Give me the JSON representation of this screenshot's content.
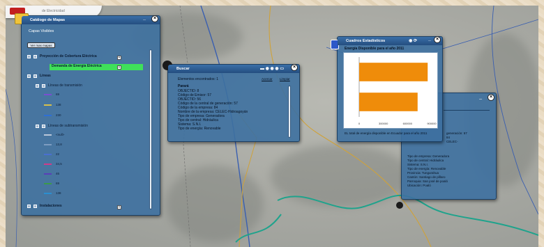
{
  "logo": {
    "caption": "de Electricidad"
  },
  "colors": {
    "panel": "#3d70a0",
    "active_row": "#3fe05a",
    "bar": "#ef8c0a"
  },
  "catalog": {
    "title": "Catálogo de Mapas",
    "subtitle": "Capas Visibles",
    "more_button": "Ver mas mapas",
    "minimize": "_",
    "layers": [
      {
        "label": "Proyección de Cobertura Eléctrica"
      },
      {
        "label": "Demanda de Energía Eléctrica",
        "active": true
      },
      {
        "label": "Líneas"
      },
      {
        "label": "Líneas de transmisión"
      },
      {
        "label": "Líneas de subtransmisión"
      },
      {
        "label": "Instalaciones"
      }
    ],
    "transmission_legend": [
      "69",
      "138",
      "230"
    ],
    "subtransmission_legend": [
      "<null>",
      "13,8",
      "22",
      "34,5",
      "46",
      "69",
      "138"
    ]
  },
  "buscar": {
    "title": "Buscar",
    "found": "Elementos encontrados: 1",
    "link_zoom": "Acercar",
    "link_clear": "Limpiar",
    "heading": "Parará",
    "lines": [
      "OBJECTID: 8",
      "Código de Emisor: 57",
      "OBJECTID: 56",
      "Código de la central de generación: 57",
      "Código de la empresa: 84",
      "Nombre de la empresa: CELEC-Hidroagoyán",
      "Tipo de empresa: Generadora",
      "Tipo de central: Hidráulica",
      "Sistema: S.N.I.",
      "Tipo de energía: Renovable"
    ]
  },
  "stats": {
    "title": "Cuadros Estadísticos",
    "chart_title": "Energía Disponible para el año 2011",
    "note": "EL total de energía disponible en Ecuador para el año 2011",
    "minimize": "_"
  },
  "chart_data": {
    "type": "bar",
    "orientation": "horizontal",
    "title": "Energía Disponible para el año 2011",
    "categories": [
      "",
      ""
    ],
    "values": [
      850000,
      725000
    ],
    "xlim": [
      0,
      900000
    ],
    "x_ticks": [
      "0",
      "300000",
      "600000",
      "900000"
    ],
    "grid": false
  },
  "detail": {
    "lines": [
      "generación: 57",
      "84",
      "CELEC-",
      "Tipo de empresa: Generadora",
      "Tipo de central: Hidráulica",
      "Sistema: S.N.I.",
      "Tipo de energía: Renovable",
      "Provincia: Tungurahua",
      "Cantón: Santiago de píllaro",
      "Parroquia: San josé de poaló",
      "Ubicación: Poaló"
    ],
    "minimize": "_"
  },
  "close_glyph": "×"
}
